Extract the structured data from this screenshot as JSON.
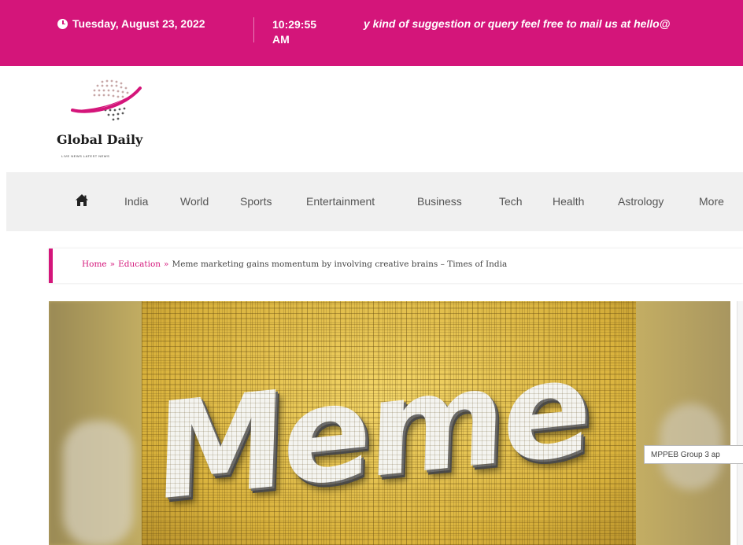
{
  "topbar": {
    "date": "Tuesday, August 23, 2022",
    "time": "10:29:55 AM",
    "ticker": "y kind of suggestion or query feel free to mail us at hello@",
    "accent_color": "#d4157a"
  },
  "logo": {
    "brand": "Global Daily",
    "tagline": "LIVE NEWS LATEST NEWS"
  },
  "nav": {
    "home_icon": "home-icon",
    "items": [
      {
        "label": "India"
      },
      {
        "label": "World"
      },
      {
        "label": "Sports"
      },
      {
        "label": "Entertainment"
      },
      {
        "label": "Business"
      },
      {
        "label": "Tech"
      },
      {
        "label": "Health"
      },
      {
        "label": "Astrology"
      },
      {
        "label": "More"
      }
    ]
  },
  "breadcrumb": {
    "home": "Home",
    "category": "Education",
    "current": "Meme marketing gains momentum by involving creative brains – Times of India",
    "separator": "»"
  },
  "hero": {
    "image_text": "Meme"
  },
  "tooltip": {
    "text": "MPPEB Group 3 ap"
  }
}
